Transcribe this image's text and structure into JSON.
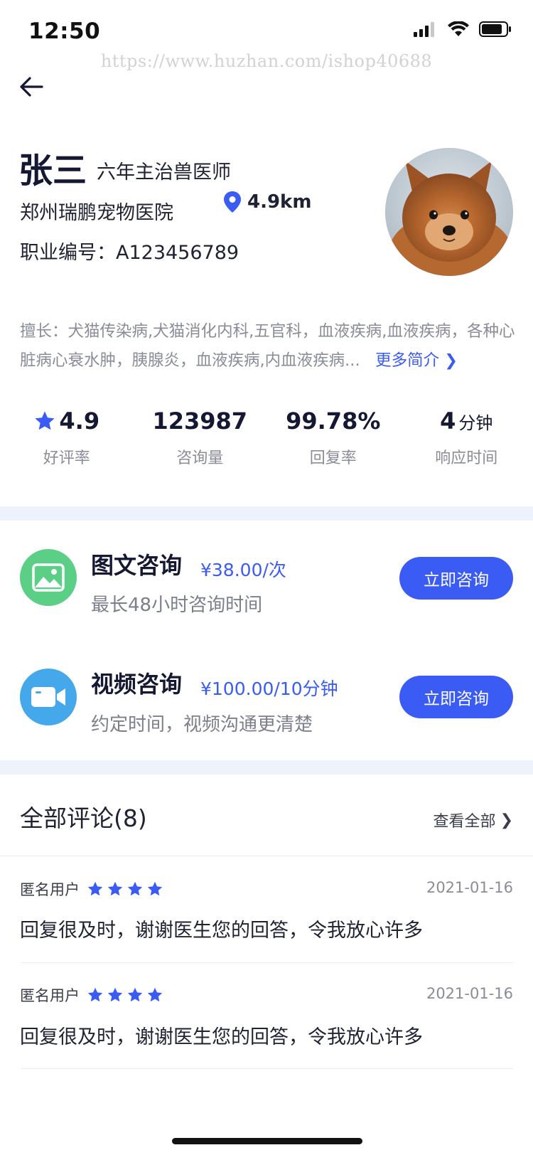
{
  "status_bar": {
    "time": "12:50"
  },
  "watermark": "https://www.huzhan.com/ishop40688",
  "doctor": {
    "name": "张三",
    "title": "六年主治兽医师",
    "hospital": "郑州瑞鹏宠物医院",
    "distance": "4.9km",
    "license": "职业编号：A123456789",
    "expertise": "擅长：犬猫传染病,犬猫消化内科,五官科，血液疾病,血液疾病，各种心脏病心衰水肿，胰腺炎，血液疾病,内血液疾病...",
    "more_intro": "更多简介"
  },
  "stats": [
    {
      "value": "4.9",
      "unit": "",
      "label": "好评率",
      "icon": "star-icon"
    },
    {
      "value": "123987",
      "unit": "",
      "label": "咨询量"
    },
    {
      "value": "99.78%",
      "unit": "",
      "label": "回复率"
    },
    {
      "value": "4",
      "unit": "分钟",
      "label": "响应时间"
    }
  ],
  "services": [
    {
      "title": "图文咨询",
      "price": "¥38.00/次",
      "desc": "最长48小时咨询时间",
      "button": "立即咨询",
      "icon": "image-icon",
      "color": "#5ccf86"
    },
    {
      "title": "视频咨询",
      "price": "¥100.00/10分钟",
      "desc": "约定时间，视频沟通更清楚",
      "button": "立即咨询",
      "icon": "video-camera-icon",
      "color": "#44a8ea"
    }
  ],
  "reviews": {
    "title": "全部评论(8)",
    "view_all": "查看全部",
    "items": [
      {
        "user": "匿名用户",
        "rating": 4,
        "date": "2021-01-16",
        "text": "回复很及时，谢谢医生您的回答，令我放心许多"
      },
      {
        "user": "匿名用户",
        "rating": 4,
        "date": "2021-01-16",
        "text": "回复很及时，谢谢医生您的回答，令我放心许多"
      }
    ]
  },
  "colors": {
    "accent": "#3b5cf4",
    "band": "#eef2fb"
  }
}
